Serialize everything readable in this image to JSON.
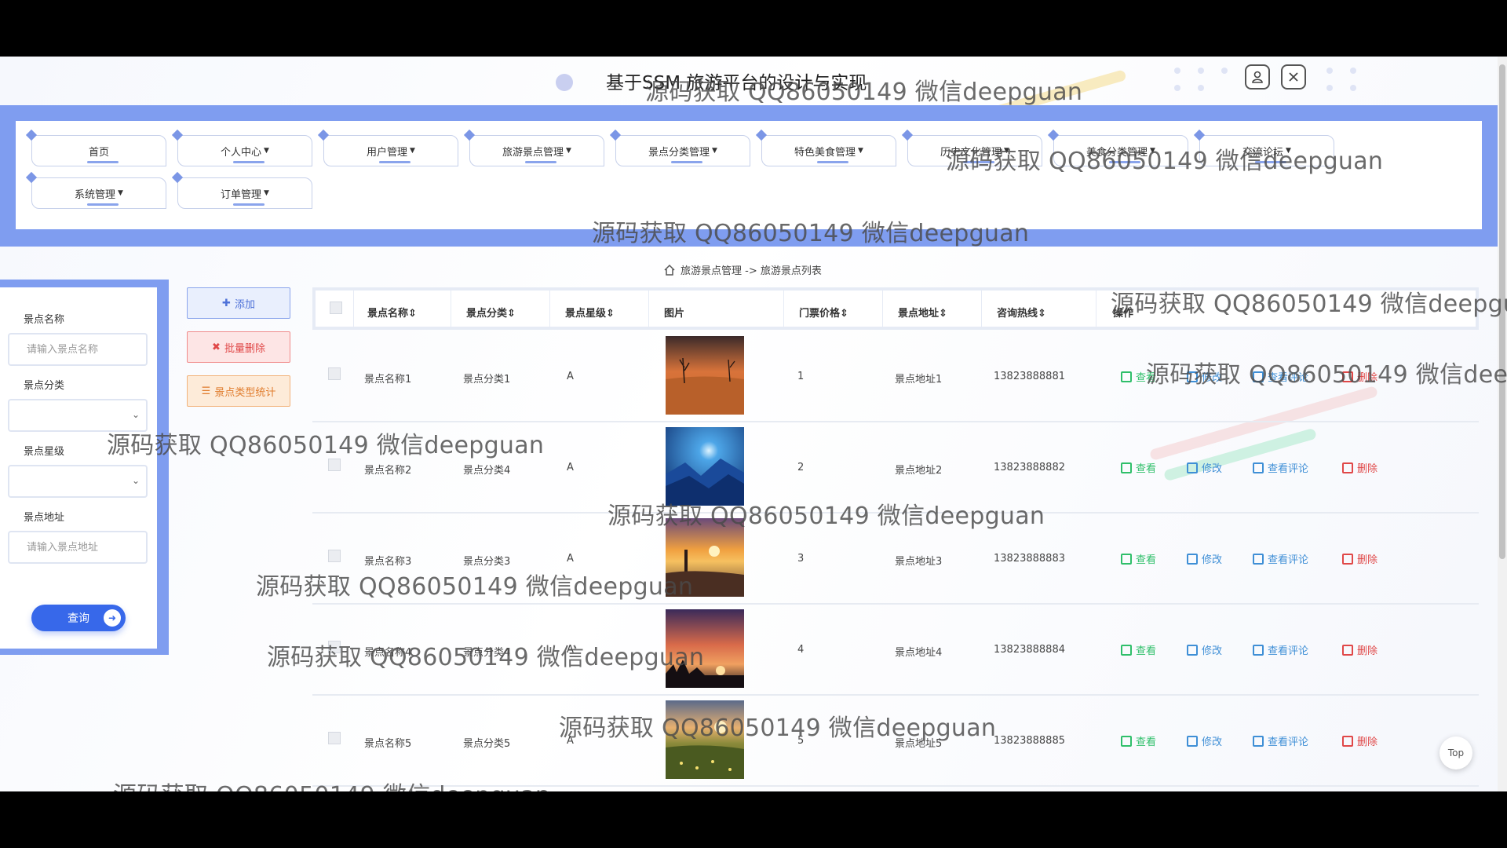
{
  "header": {
    "title": "基于SSM 旅游平台的设计与实现",
    "user_icon": "user-icon",
    "close_icon": "close-icon"
  },
  "nav": {
    "items": [
      {
        "label": "首页",
        "has_caret": false
      },
      {
        "label": "个人中心",
        "has_caret": true
      },
      {
        "label": "用户管理",
        "has_caret": true
      },
      {
        "label": "旅游景点管理",
        "has_caret": true
      },
      {
        "label": "景点分类管理",
        "has_caret": true
      },
      {
        "label": "特色美食管理",
        "has_caret": true
      },
      {
        "label": "历史文化管理",
        "has_caret": true
      },
      {
        "label": "美食分类管理",
        "has_caret": true
      },
      {
        "label": "交流论坛",
        "has_caret": true
      },
      {
        "label": "系统管理",
        "has_caret": true
      },
      {
        "label": "订单管理",
        "has_caret": true
      }
    ]
  },
  "watermark": "源码获取 QQ86050149 微信deepguan",
  "breadcrumb": {
    "home_icon": "home-icon",
    "text": "旅游景点管理 -> 旅游景点列表"
  },
  "search": {
    "name_label": "景点名称",
    "name_placeholder": "请输入景点名称",
    "category_label": "景点分类",
    "rating_label": "景点星级",
    "address_label": "景点地址",
    "address_placeholder": "请输入景点地址",
    "query_label": "查询"
  },
  "actions": {
    "add_label": "添加",
    "batch_delete_label": "批量删除",
    "stats_label": "景点类型统计"
  },
  "table": {
    "columns": [
      "景点名称",
      "景点分类",
      "景点星级",
      "图片",
      "门票价格",
      "景点地址",
      "咨询热线",
      "操作"
    ],
    "rows": [
      {
        "name": "景点名称1",
        "category": "景点分类1",
        "rating": "A",
        "price": "1",
        "address": "景点地址1",
        "phone": "13823888881",
        "image": "desert-sunset"
      },
      {
        "name": "景点名称2",
        "category": "景点分类4",
        "rating": "A",
        "price": "2",
        "address": "景点地址2",
        "phone": "13823888882",
        "image": "blue-mountain-night"
      },
      {
        "name": "景点名称3",
        "category": "景点分类3",
        "rating": "A",
        "price": "3",
        "address": "景点地址3",
        "phone": "13823888883",
        "image": "sea-sunset"
      },
      {
        "name": "景点名称4",
        "category": "景点分类4",
        "rating": "A",
        "price": "4",
        "address": "景点地址4",
        "phone": "13823888884",
        "image": "forest-sunset"
      },
      {
        "name": "景点名称5",
        "category": "景点分类5",
        "rating": "A",
        "price": "5",
        "address": "景点地址5",
        "phone": "13823888885",
        "image": "field-sunset"
      }
    ],
    "ops": {
      "view": "查看",
      "edit": "修改",
      "comments": "查看评论",
      "delete": "删除"
    }
  },
  "top_button": "Top",
  "colors": {
    "nav_band": "#7f9df0",
    "primary": "#3768ea",
    "view": "#2fbf6a",
    "edit": "#3f8fd6",
    "delete": "#e04848"
  }
}
